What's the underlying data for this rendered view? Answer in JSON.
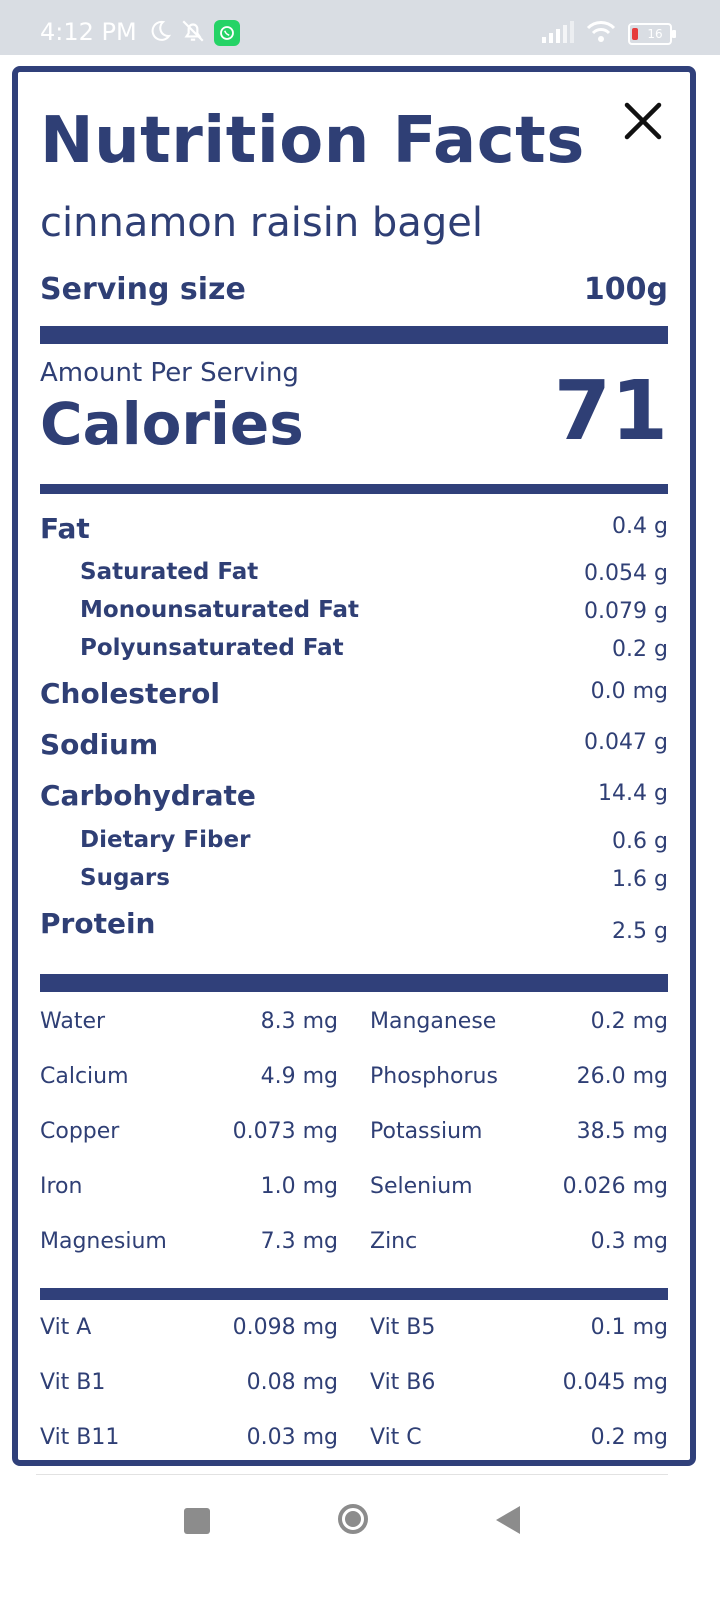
{
  "status_bar": {
    "time": "4:12 PM",
    "battery": "16",
    "icons": [
      "moon-icon",
      "bell-off-icon",
      "whatsapp-icon",
      "signal-icon",
      "wifi-icon",
      "battery-icon"
    ]
  },
  "label": {
    "title": "Nutrition Facts",
    "food_name": "cinnamon raisin bagel",
    "serving_label": "Serving size",
    "serving_value": "100g",
    "amount_label": "Amount Per Serving",
    "calories_label": "Calories",
    "calories_value": "71"
  },
  "nutrients": [
    {
      "label": "Fat",
      "value": "0.4 g"
    },
    {
      "label": "Saturated Fat",
      "value": "0.054 g"
    },
    {
      "label": "Monounsaturated Fat",
      "value": "0.079 g"
    },
    {
      "label": "Polyunsaturated Fat",
      "value": "0.2 g"
    },
    {
      "label": "Cholesterol",
      "value": "0.0 mg"
    },
    {
      "label": "Sodium",
      "value": "0.047 g"
    },
    {
      "label": "Carbohydrate",
      "value": "14.4 g"
    },
    {
      "label": "Dietary Fiber",
      "value": "0.6 g"
    },
    {
      "label": "Sugars",
      "value": "1.6 g"
    },
    {
      "label": "Protein",
      "value": "2.5 g"
    }
  ],
  "minerals": [
    {
      "left_label": "Water",
      "left_value": "8.3 mg",
      "right_label": "Manganese",
      "right_value": "0.2 mg"
    },
    {
      "left_label": "Calcium",
      "left_value": "4.9 mg",
      "right_label": "Phosphorus",
      "right_value": "26.0 mg"
    },
    {
      "left_label": "Copper",
      "left_value": "0.073 mg",
      "right_label": "Potassium",
      "right_value": "38.5 mg"
    },
    {
      "left_label": "Iron",
      "left_value": "1.0 mg",
      "right_label": "Selenium",
      "right_value": "0.026 mg"
    },
    {
      "left_label": "Magnesium",
      "left_value": "7.3 mg",
      "right_label": "Zinc",
      "right_value": "0.3 mg"
    }
  ],
  "vitamins": [
    {
      "left_label": "Vit A",
      "left_value": "0.098 mg",
      "right_label": "Vit B5",
      "right_value": "0.1 mg"
    },
    {
      "left_label": "Vit B1",
      "left_value": "0.08 mg",
      "right_label": "Vit B6",
      "right_value": "0.045 mg"
    },
    {
      "left_label": "Vit B11",
      "left_value": "0.03 mg",
      "right_label": "Vit C",
      "right_value": "0.2 mg"
    }
  ],
  "colors": {
    "primary": "#30407a",
    "text": "#2f3f75"
  }
}
